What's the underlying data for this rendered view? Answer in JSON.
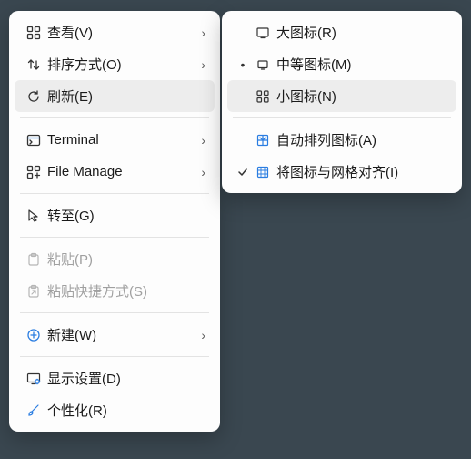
{
  "left": {
    "view": "查看(V)",
    "sort": "排序方式(O)",
    "refresh": "刷新(E)",
    "terminal": "Terminal",
    "filemanage": "File Manage",
    "goto": "转至(G)",
    "paste": "粘贴(P)",
    "paste_shortcut": "粘贴快捷方式(S)",
    "new": "新建(W)",
    "display_settings": "显示设置(D)",
    "personalize": "个性化(R)"
  },
  "right": {
    "large_icons": "大图标(R)",
    "medium_icons": "中等图标(M)",
    "small_icons": "小图标(N)",
    "auto_arrange": "自动排列图标(A)",
    "align_grid": "将图标与网格对齐(I)"
  }
}
